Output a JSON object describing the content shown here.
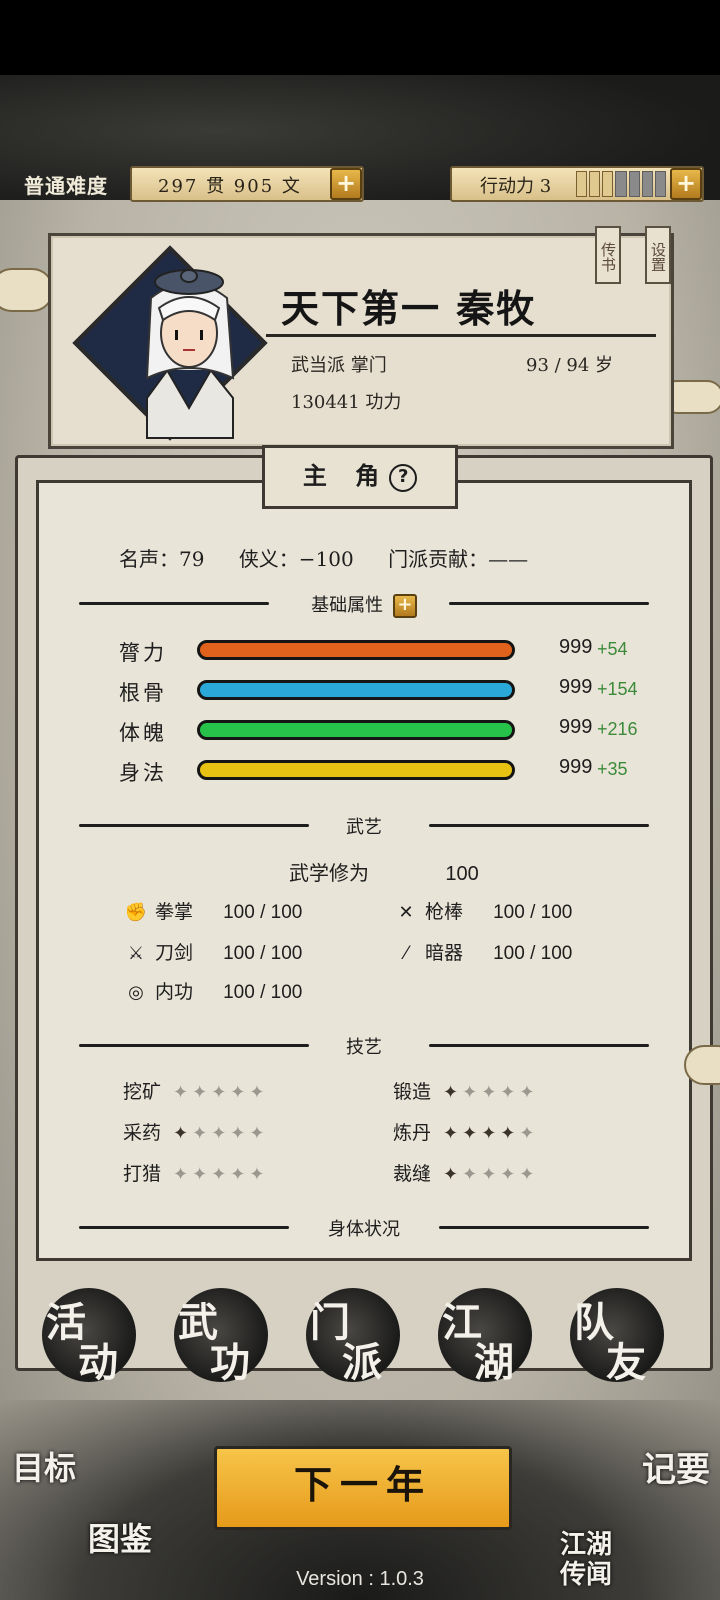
{
  "topbar": {
    "difficulty": "普通难度",
    "money": "297 贯  905  文",
    "action_label": "行动力 3",
    "action_points": 3,
    "action_points_max": 7
  },
  "character": {
    "title_name": "天下第一  秦牧",
    "sect_role": "武当派 掌门",
    "age": "93 / 94 岁",
    "power": "130441 功力",
    "tag_letter": "传书",
    "tag_settings": "设置"
  },
  "tab": {
    "title": "主 角"
  },
  "stats": {
    "fame": "名声：79",
    "chivalry": "侠义：−100",
    "contribution": "门派贡献：——"
  },
  "sections": {
    "basic": "基础属性",
    "martial": "武艺",
    "crafts": "技艺",
    "body": "身体状况"
  },
  "attributes": [
    {
      "label": "膂力",
      "value": "999",
      "bonus": "+54",
      "color": "#e0621c"
    },
    {
      "label": "根骨",
      "value": "999",
      "bonus": "+154",
      "color": "#2aa8d8"
    },
    {
      "label": "体魄",
      "value": "999",
      "bonus": "+216",
      "color": "#27c24a"
    },
    {
      "label": "身法",
      "value": "999",
      "bonus": "+35",
      "color": "#e8c212"
    }
  ],
  "martial": {
    "summary_label": "武学修为",
    "summary_value": "100",
    "skills": [
      {
        "label": "拳掌",
        "value": "100 / 100",
        "icon": "fist-icon"
      },
      {
        "label": "枪棒",
        "value": "100 / 100",
        "icon": "spear-icon"
      },
      {
        "label": "刀剑",
        "value": "100 / 100",
        "icon": "sword-icon"
      },
      {
        "label": "暗器",
        "value": "100 / 100",
        "icon": "dart-icon"
      },
      {
        "label": "内功",
        "value": "100 / 100",
        "icon": "qi-icon"
      }
    ]
  },
  "crafts": [
    {
      "label": "挖矿",
      "level": 0,
      "max": 5
    },
    {
      "label": "锻造",
      "level": 1,
      "max": 5
    },
    {
      "label": "采药",
      "level": 1,
      "max": 5
    },
    {
      "label": "炼丹",
      "level": 4,
      "max": 5
    },
    {
      "label": "打猎",
      "level": 0,
      "max": 5
    },
    {
      "label": "裁缝",
      "level": 1,
      "max": 5
    }
  ],
  "actions": [
    {
      "c1": "活",
      "c2": "动"
    },
    {
      "c1": "武",
      "c2": "功"
    },
    {
      "c1": "门",
      "c2": "派"
    },
    {
      "c1": "江",
      "c2": "湖"
    },
    {
      "c1": "队",
      "c2": "友"
    }
  ],
  "bottom": {
    "next_year": "下一年",
    "goal": "目标",
    "atlas": "图鉴",
    "notes": "记要",
    "rumors": "江湖传闻"
  },
  "version": "Version : 1.0.3"
}
